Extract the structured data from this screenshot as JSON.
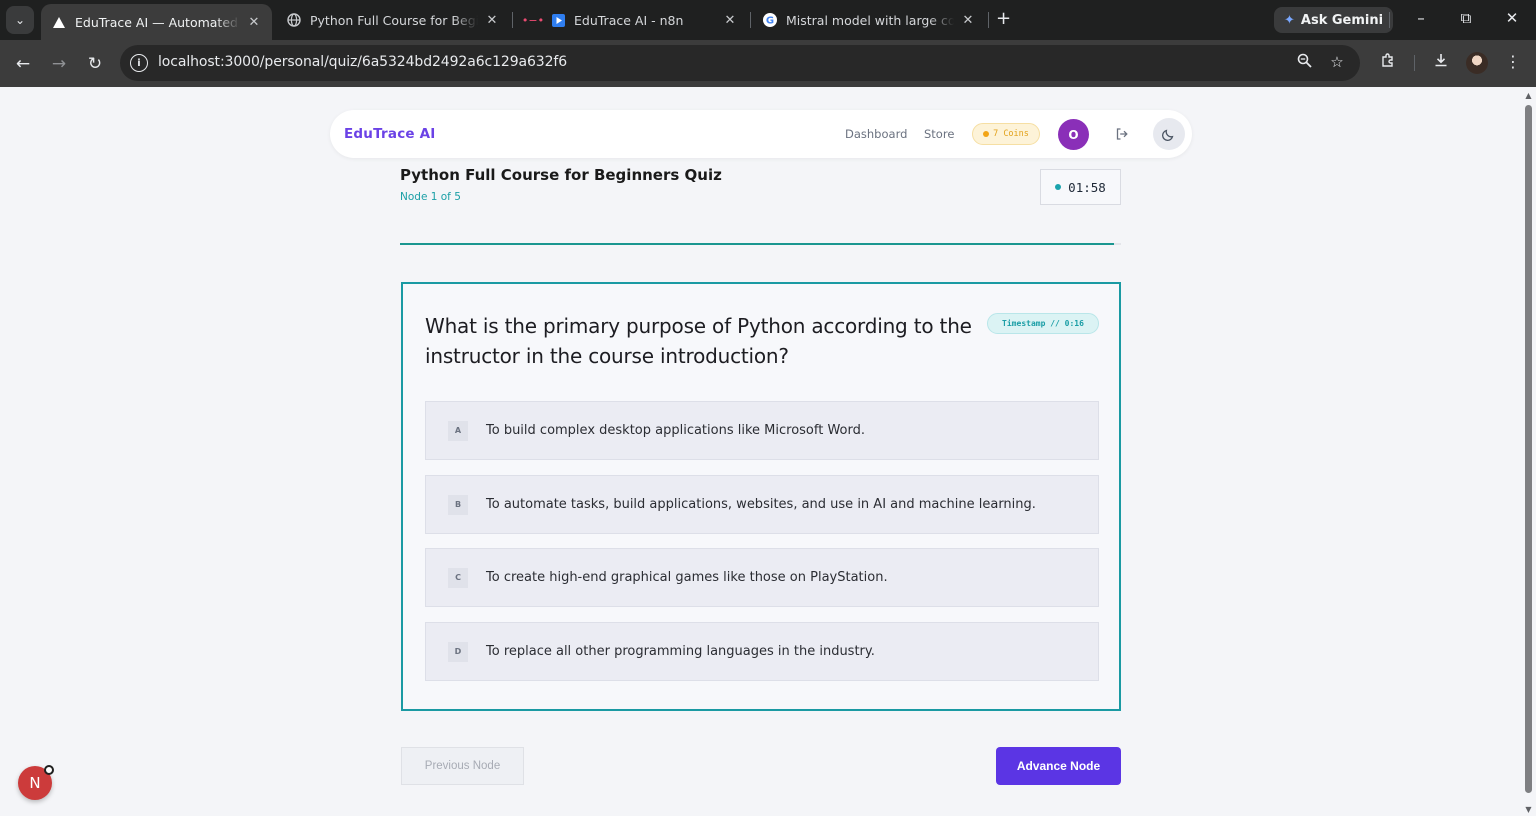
{
  "browser": {
    "tabs": [
      {
        "title": "EduTrace AI — Automated Vide",
        "active": true
      },
      {
        "title": "Python Full Course for Beginners",
        "active": false
      },
      {
        "title": "EduTrace AI - n8n",
        "active": false
      },
      {
        "title": "Mistral model with large conrtext",
        "active": false
      }
    ],
    "ask_gemini": "Ask Gemini",
    "url": "localhost:3000/personal/quiz/6a5324bd2492a6c129a632f6"
  },
  "nav": {
    "brand": "EduTrace AI",
    "links": [
      "Dashboard",
      "Store"
    ],
    "coins": "7 Coins",
    "avatar_initial": "O"
  },
  "quiz": {
    "title": "Python Full Course for Beginners Quiz",
    "node_label": "Node 1 of 5",
    "timer": "01:58",
    "progress": 0.99,
    "question": "What is the primary purpose of Python according to the instructor in the course introduction?",
    "timestamp": "Timestamp // 0:16",
    "options": [
      {
        "key": "A",
        "text": "To build complex desktop applications like Microsoft Word."
      },
      {
        "key": "B",
        "text": "To automate tasks, build applications, websites, and use in AI and machine learning."
      },
      {
        "key": "C",
        "text": "To create high-end graphical games like those on PlayStation."
      },
      {
        "key": "D",
        "text": "To replace all other programming languages in the industry."
      }
    ],
    "prev_label": "Previous Node",
    "next_label": "Advance Node"
  },
  "fab_label": "N",
  "colors": {
    "brand": "#6b42e6",
    "accent_teal": "#1a9aa3",
    "primary_button": "#5b35e4",
    "coin": "#f2a516"
  }
}
